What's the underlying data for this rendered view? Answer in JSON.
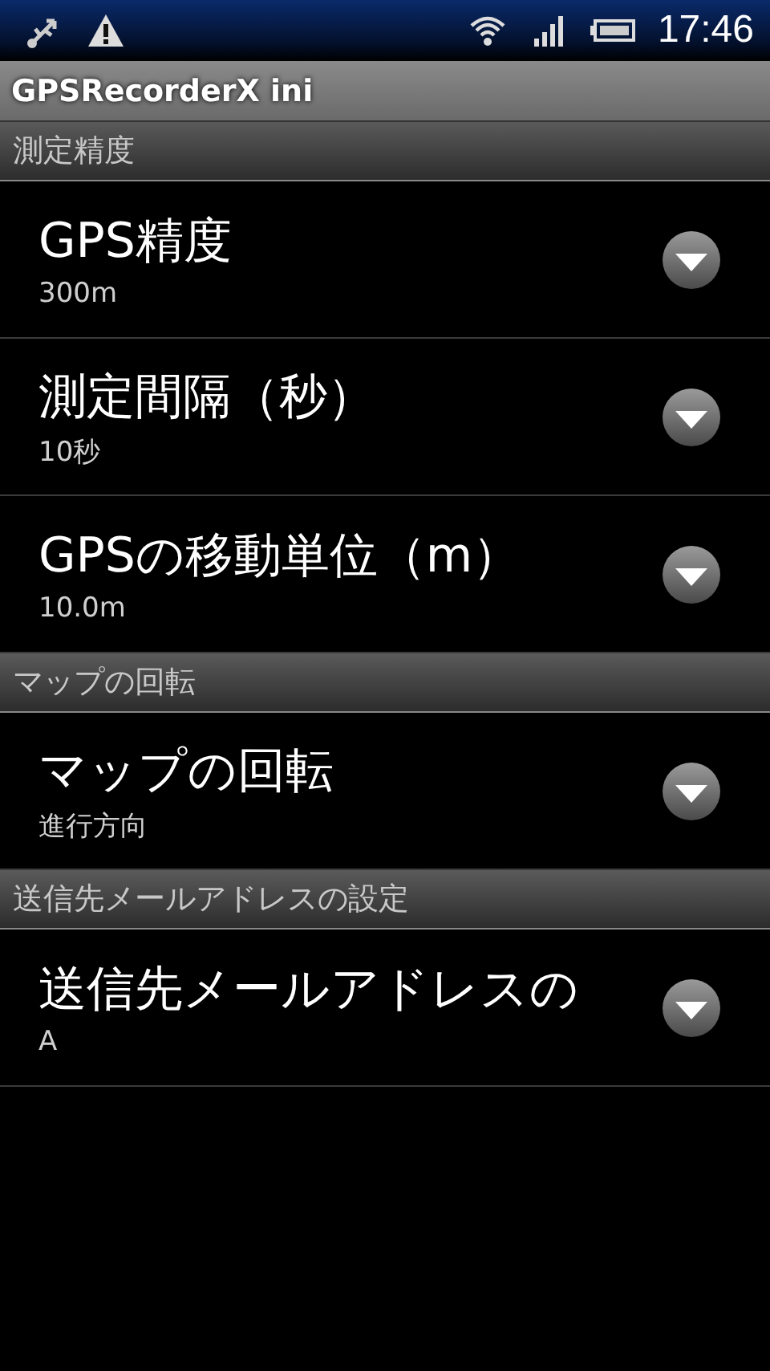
{
  "status_bar": {
    "time": "17:46"
  },
  "title_bar": {
    "title": "GPSRecorderX ini"
  },
  "sections": [
    {
      "header": "測定精度",
      "items": [
        {
          "title": "GPS精度",
          "summary": "300m"
        },
        {
          "title": "測定間隔（秒）",
          "summary": "10秒"
        },
        {
          "title": "GPSの移動単位（m）",
          "summary": "10.0m"
        }
      ]
    },
    {
      "header": "マップの回転",
      "items": [
        {
          "title": "マップの回転",
          "summary": "進行方向"
        }
      ]
    },
    {
      "header": "送信先メールアドレスの設定",
      "items": [
        {
          "title": "送信先メールアドレスの",
          "summary": "A"
        }
      ]
    }
  ]
}
